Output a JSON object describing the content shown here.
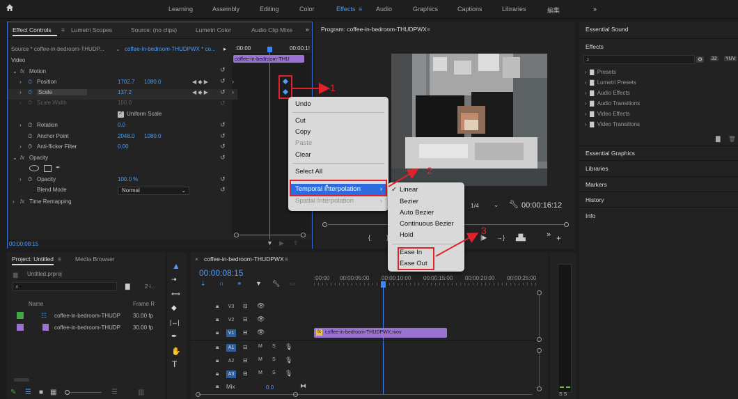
{
  "workspaces": [
    "Learning",
    "Assembly",
    "Editing",
    "Color",
    "Effects",
    "Audio",
    "Graphics",
    "Captions",
    "Libraries",
    "編集"
  ],
  "workspace_active": "Effects",
  "top_more": "»",
  "effect_controls": {
    "tabs": [
      "Effect Controls",
      "Lumetri Scopes",
      "Source: (no clips)",
      "Lumetri Color",
      "Audio Clip Mixe"
    ],
    "source": "Source * coffee-in-bedroom-THUDP...",
    "sequence": "coffee-in-bedroom-THUDPWX * co...",
    "tc_start": ":00:00",
    "tc_end": "00:00:1!",
    "clip_bar": "coffee-in-bedroom-THU",
    "video_label": "Video",
    "motion": "Motion",
    "position_label": "Position",
    "position_x": "1702.7",
    "position_y": "1080.0",
    "scale_label": "Scale",
    "scale_value": "137.2",
    "scale_width_label": "Scale Width",
    "scale_width_value": "100.0",
    "uniform_scale": "Uniform Scale",
    "rotation_label": "Rotation",
    "rotation_value": "0.0",
    "anchor_label": "Anchor Point",
    "anchor_x": "2048.0",
    "anchor_y": "1080.0",
    "antiflicker_label": "Anti-flicker Filter",
    "antiflicker_value": "0.00",
    "opacity_section": "Opacity",
    "opacity_label": "Opacity",
    "opacity_value": "100.0 %",
    "blend_label": "Blend Mode",
    "blend_value": "Normal",
    "time_remap": "Time Remapping",
    "timecode": "00:00:08:15"
  },
  "program": {
    "title": "Program: coffee-in-bedroom-THUDPWX",
    "resolution": "1/4",
    "timecode": "00:00:16:12"
  },
  "context_menu": {
    "items": [
      "Undo",
      "Cut",
      "Copy",
      "Paste",
      "Clear",
      "Select All",
      "Temporal Interpolation",
      "Spatial Interpolation"
    ],
    "disabled": [
      "Paste",
      "Spatial Interpolation"
    ]
  },
  "submenu": {
    "items": [
      "Linear",
      "Bezier",
      "Auto Bezier",
      "Continuous Bezier",
      "Hold",
      "Ease In",
      "Ease Out"
    ],
    "checked": "Linear"
  },
  "annotations": [
    "1",
    "2",
    "3"
  ],
  "right_panel": {
    "essential_sound": "Essential Sound",
    "effects": "Effects",
    "tree": [
      "Presets",
      "Lumetri Presets",
      "Audio Effects",
      "Audio Transitions",
      "Video Effects",
      "Video Transitions"
    ],
    "sections": [
      "Essential Graphics",
      "Libraries",
      "Markers",
      "History",
      "Info"
    ]
  },
  "project": {
    "tabs": [
      "Project: Untitled",
      "Media Browser"
    ],
    "file": "Untitled.prproj",
    "count": "2 i...",
    "col_name": "Name",
    "col_rate": "Frame R",
    "items": [
      {
        "name": "coffee-in-bedroom-THUDP",
        "rate": "30.00 fp",
        "color": "#3fa845"
      },
      {
        "name": "coffee-in-bedroom-THUDP",
        "rate": "30.00 fp",
        "color": "#9a72d4"
      }
    ]
  },
  "timeline": {
    "title": "coffee-in-bedroom-THUDPWX",
    "timecode": "00:00:08:15",
    "ruler": [
      ":00:00",
      "00:00:05:00",
      "00:00:10:00",
      "00:00:15:00",
      "00:00:20:00",
      "00:00:25:00"
    ],
    "tracks": [
      "V3",
      "V2",
      "V1",
      "A1",
      "A2",
      "A3"
    ],
    "mix_label": "Mix",
    "mix_value": "0.0",
    "clip": "coffee-in-bedroom-THUDPWX.mov",
    "track_letters": [
      "M",
      "S"
    ]
  },
  "meter_label": "S S"
}
